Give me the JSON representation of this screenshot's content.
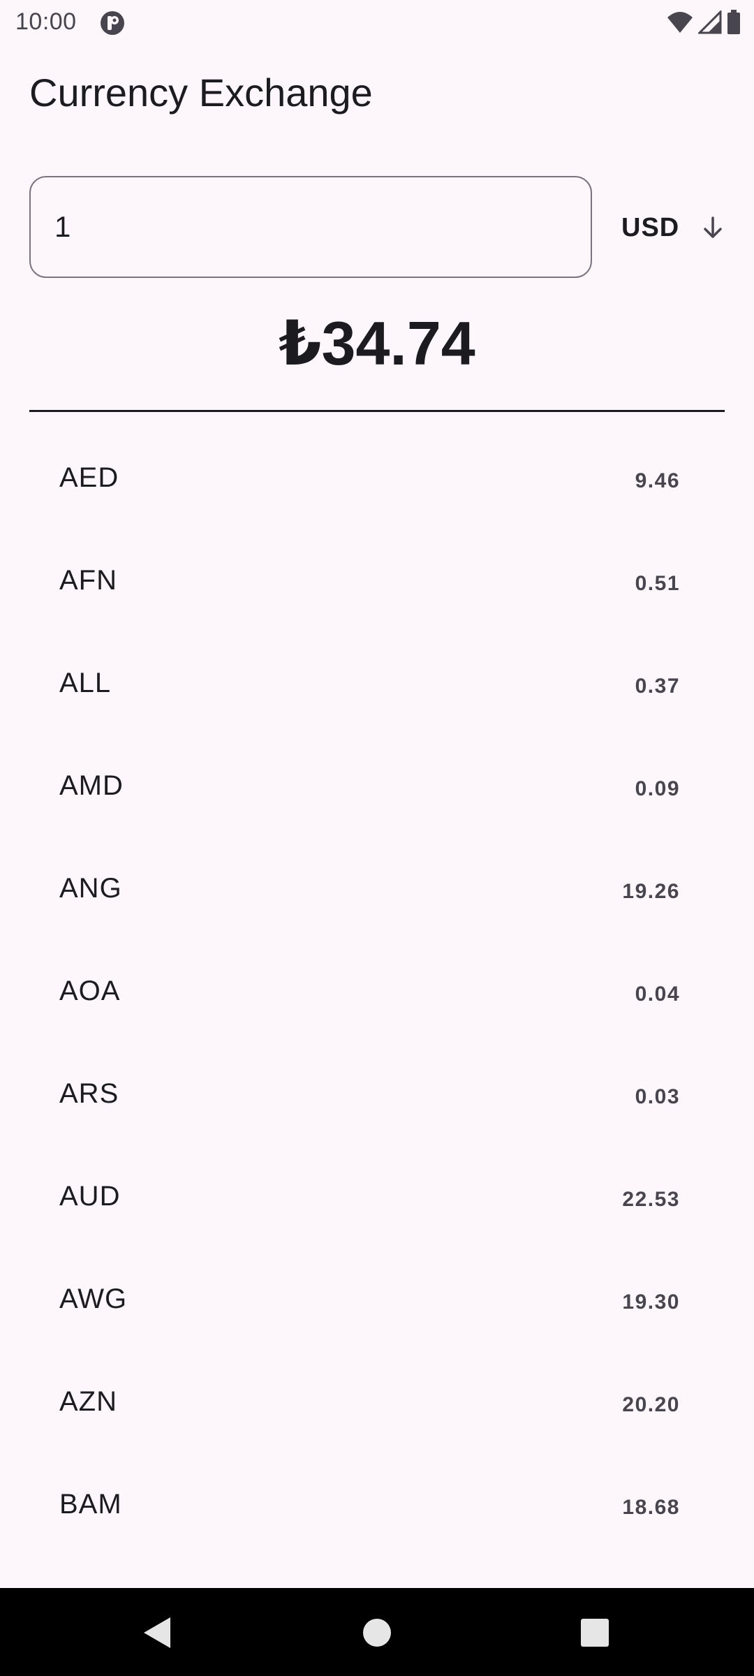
{
  "status_bar": {
    "time": "10:00"
  },
  "header": {
    "title": "Currency Exchange"
  },
  "converter": {
    "amount_value": "1",
    "base_currency": "USD",
    "converted_amount": "₺34.74"
  },
  "rates": [
    {
      "code": "AED",
      "value": "9.46"
    },
    {
      "code": "AFN",
      "value": "0.51"
    },
    {
      "code": "ALL",
      "value": "0.37"
    },
    {
      "code": "AMD",
      "value": "0.09"
    },
    {
      "code": "ANG",
      "value": "19.26"
    },
    {
      "code": "AOA",
      "value": "0.04"
    },
    {
      "code": "ARS",
      "value": "0.03"
    },
    {
      "code": "AUD",
      "value": "22.53"
    },
    {
      "code": "AWG",
      "value": "19.30"
    },
    {
      "code": "AZN",
      "value": "20.20"
    },
    {
      "code": "BAM",
      "value": "18.68"
    }
  ],
  "colors": {
    "background": "#FDF7FC",
    "text": "#1C1B1F",
    "secondary_text": "#49454F",
    "outline": "#79747E",
    "nav_bar": "#000000"
  },
  "icons": {
    "status_app": "app-notification-icon",
    "wifi": "wifi-icon",
    "signal": "cell-signal-icon",
    "battery": "battery-icon",
    "dropdown": "arrow-down-icon",
    "nav_back": "back-triangle-icon",
    "nav_home": "home-circle-icon",
    "nav_recents": "recents-square-icon"
  }
}
